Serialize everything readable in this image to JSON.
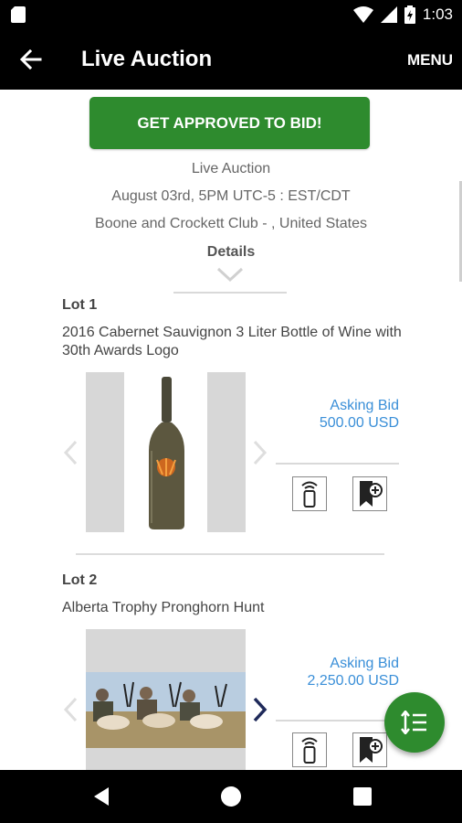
{
  "status_bar": {
    "time": "1:03",
    "icons": [
      "sd-card-icon",
      "wifi-icon",
      "signal-icon",
      "battery-icon"
    ]
  },
  "app_bar": {
    "title": "Live Auction",
    "menu_label": "MENU",
    "back_icon": "arrow-left-icon"
  },
  "auction": {
    "approve_button": "GET APPROVED TO BID!",
    "type": "Live Auction",
    "datetime": "August 03rd, 5PM UTC-5 : EST/CDT",
    "location": "Boone and Crockett Club - , United States",
    "details_label": "Details"
  },
  "lots": [
    {
      "label": "Lot 1",
      "title": "2016 Cabernet Sauvignon 3 Liter Bottle of Wine with 30th Awards Logo",
      "asking_label": "Asking Bid",
      "asking_value": "500.00 USD",
      "image": "wine-bottle-photo"
    },
    {
      "label": "Lot 2",
      "title": "Alberta Trophy Pronghorn Hunt",
      "asking_label": "Asking Bid",
      "asking_value": "2,250.00 USD",
      "image": "pronghorn-hunters-photo"
    }
  ],
  "colors": {
    "accent_green": "#2e8b2e",
    "link_blue": "#3a8fd8",
    "bar_black": "#000000"
  },
  "fab_icon": "sort-lines-icon",
  "nav_icons": [
    "back-triangle-icon",
    "home-circle-icon",
    "recents-square-icon"
  ]
}
